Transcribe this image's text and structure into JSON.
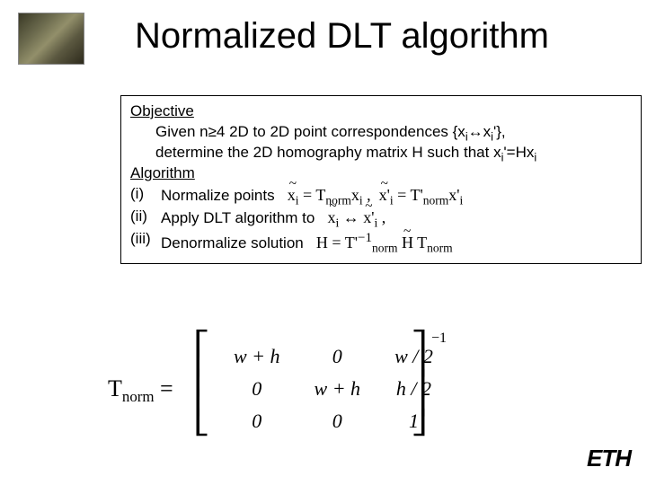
{
  "title": "Normalized DLT algorithm",
  "box": {
    "heading_objective": "Objective",
    "objective_line1": "Given n≥4 2D to 2D point correspondences {xᵢ↔xᵢ'},",
    "objective_line2": "determine the 2D homography matrix H such that xᵢ'=Hxᵢ",
    "heading_algorithm": "Algorithm",
    "step1_label": "(i)",
    "step1_text": "Normalize points",
    "step1_eq": "x̃ᵢ = T_norm xᵢ ,  x̃ᵢ' = T'_norm xᵢ'",
    "step2_label": "(ii)",
    "step2_text": "Apply DLT algorithm to",
    "step2_eq": "x̃ᵢ ↔ x̃ᵢ' ,",
    "step3_label": "(iii)",
    "step3_text": "Denormalize solution",
    "step3_eq": "H = T'⁻¹_norm H̃ T_norm"
  },
  "tnorm": {
    "lhs": "T_norm =",
    "row1": [
      "w + h",
      "0",
      "w / 2"
    ],
    "row2": [
      "0",
      "w + h",
      "h / 2"
    ],
    "row3": [
      "0",
      "0",
      "1"
    ],
    "exponent": "−1"
  },
  "footer_logo": "ETH"
}
